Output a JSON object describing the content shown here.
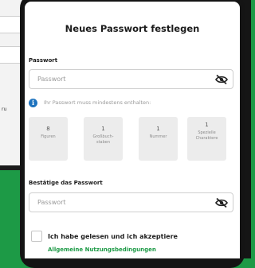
{
  "page": {
    "title": "Neues Passwort festlegen"
  },
  "background_phone": {
    "partial_text": "ru"
  },
  "password": {
    "label": "Passwort",
    "placeholder": "Passwort",
    "toggle_icon": "eye-off-icon"
  },
  "requirements": {
    "info_icon": "info-icon",
    "intro": "Ihr Passwort muss mindestens enthalten:",
    "items": [
      {
        "count": "8",
        "text": "Figuren"
      },
      {
        "count": "1",
        "text": "Großbuch-\nstaben"
      },
      {
        "count": "1",
        "text": "Nummer"
      },
      {
        "count": "1",
        "text": "Spezielle\nCharaktere"
      }
    ]
  },
  "confirm": {
    "label": "Bestätige das Passwort",
    "placeholder": "Passwort",
    "toggle_icon": "eye-off-icon"
  },
  "terms": {
    "checked": false,
    "label": "Ich habe gelesen und ich akzeptiere",
    "link": "Allgemeine Nutzungsbedingungen"
  },
  "colors": {
    "background": "#1d9a46",
    "link": "#1d9a46",
    "info": "#1e73be"
  }
}
